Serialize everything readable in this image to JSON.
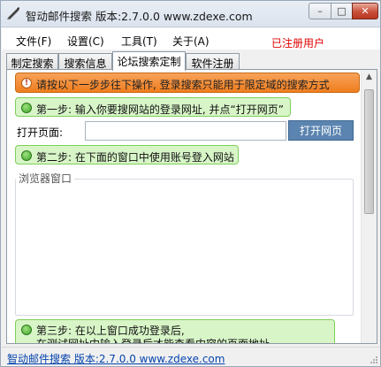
{
  "window": {
    "title": "智动邮件搜索 版本:2.7.0.0 www.zdexe.com",
    "buttons": {
      "minimize": "–",
      "maximize": "□",
      "close": "✕"
    }
  },
  "menu": {
    "items": [
      "文件(F)",
      "设置(C)",
      "工具(T)",
      "关于(A)"
    ],
    "registered": "已注册用户"
  },
  "tabs": [
    "制定搜索",
    "搜索信息",
    "论坛搜索定制",
    "软件注册"
  ],
  "active_tab": "论坛搜索定制",
  "panel": {
    "warning": "请按以下一步步往下操作, 登录搜索只能用于限定域的搜索方式",
    "step1": "第一步: 输入你要搜网站的登录网址, 并点“打开网页”",
    "open_label": "打开页面:",
    "url_value": "",
    "open_button": "打开网页",
    "step2": "第二步: 在下面的窗口中使用账号登入网站",
    "browser_label": "浏览器窗口",
    "step3_line1": "第三步: 在以上窗口成功登录后,",
    "step3_line2": "在测试网址中输入登录后才能查看内容的页面地址"
  },
  "status": {
    "link": "智动邮件搜索 版本:2.7.0.0 www.zdexe.com"
  },
  "colors": {
    "warning_bg": "#ef7d1e",
    "step_bg": "#d8f5c8",
    "open_button_bg": "#5b84b0",
    "registered_text": "#e00000"
  }
}
